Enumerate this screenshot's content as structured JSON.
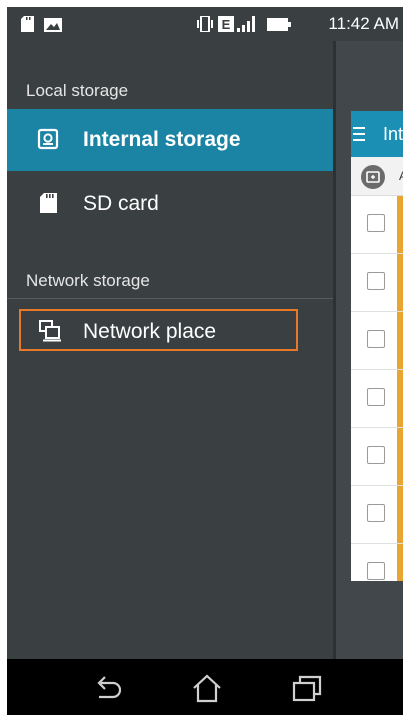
{
  "status_bar": {
    "time": "11:42 AM",
    "left_icons": [
      "sd-card-icon",
      "image-icon"
    ],
    "right_icons": [
      "vibrate-icon",
      "network-e-icon",
      "signal-icon",
      "battery-icon"
    ]
  },
  "drawer": {
    "local_header": "Local storage",
    "items": [
      {
        "label": "Internal storage",
        "icon": "internal-storage-icon",
        "selected": true
      },
      {
        "label": "SD card",
        "icon": "sd-card-icon",
        "selected": false
      }
    ],
    "network_header": "Network storage",
    "network_items": [
      {
        "label": "Network place",
        "icon": "network-place-icon",
        "highlighted": true
      }
    ]
  },
  "content": {
    "toolbar_title": "Int",
    "path_text": "A",
    "rows": 7
  },
  "nav_bar": {
    "buttons": [
      "back-icon",
      "home-icon",
      "recents-icon"
    ]
  },
  "colors": {
    "drawer_bg": "#3a3f42",
    "selected_bg": "#1b84a5",
    "highlight_border": "#e8792b",
    "toolbar": "#1c8fb4",
    "row_stripe": "#e8a531"
  }
}
